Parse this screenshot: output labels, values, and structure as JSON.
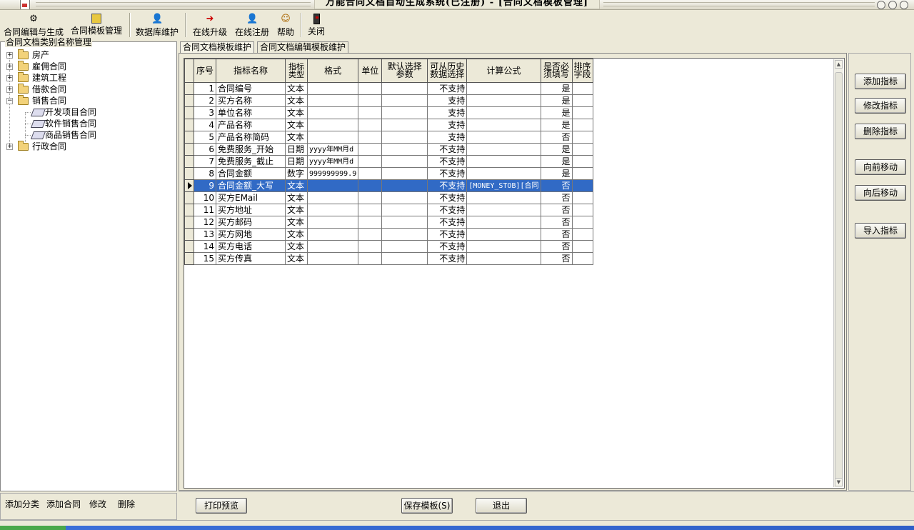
{
  "window": {
    "title": "万能合同文档自动生成系统(已注册) - [合同文档模板管理]"
  },
  "toolbar": [
    {
      "label": "合同编辑与生成",
      "icon": "gear-icon"
    },
    {
      "label": "合同模板管理",
      "icon": "template-icon"
    },
    {
      "label": "数据库维护",
      "icon": "database-person-icon"
    },
    {
      "label": "在线升级",
      "icon": "upgrade-arrow-icon"
    },
    {
      "label": "在线注册",
      "icon": "register-person-icon"
    },
    {
      "label": "帮助",
      "icon": "help-icon"
    },
    {
      "label": "关闭",
      "icon": "close-door-icon"
    }
  ],
  "left_panel": {
    "title": "合同文档类别名称管理",
    "tree": [
      {
        "label": "房产",
        "expander": "+"
      },
      {
        "label": "雇佣合同",
        "expander": "+"
      },
      {
        "label": "建筑工程",
        "expander": "+"
      },
      {
        "label": "借款合同",
        "expander": "+"
      },
      {
        "label": "销售合同",
        "expander": "−"
      },
      {
        "label": "开发项目合同",
        "expander": ""
      },
      {
        "label": "软件销售合同",
        "expander": ""
      },
      {
        "label": "商品销售合同",
        "expander": ""
      },
      {
        "label": "行政合同",
        "expander": "+"
      }
    ],
    "actions": [
      "添加分类",
      "添加合同",
      "修改",
      "删除"
    ]
  },
  "tabs": [
    "合同文档模板维护",
    "合同文档编辑模板维护"
  ],
  "grid": {
    "columns": [
      "序号",
      "指标名称",
      "指标类型",
      "格式",
      "单位",
      "默认选择参数",
      "可从历史数据选择",
      "计算公式",
      "是否必须填写",
      "排序字段"
    ],
    "rows": [
      [
        "1",
        "合同编号",
        "文本",
        "",
        "",
        "",
        "不支持",
        "",
        "是",
        ""
      ],
      [
        "2",
        "买方名称",
        "文本",
        "",
        "",
        "",
        "支持",
        "",
        "是",
        ""
      ],
      [
        "3",
        "单位名称",
        "文本",
        "",
        "",
        "",
        "支持",
        "",
        "是",
        ""
      ],
      [
        "4",
        "产品名称",
        "文本",
        "",
        "",
        "",
        "支持",
        "",
        "是",
        ""
      ],
      [
        "5",
        "产品名称简码",
        "文本",
        "",
        "",
        "",
        "支持",
        "",
        "否",
        ""
      ],
      [
        "6",
        "免费服务_开始",
        "日期",
        "yyyy年MM月d",
        "",
        "",
        "不支持",
        "",
        "是",
        ""
      ],
      [
        "7",
        "免费服务_截止",
        "日期",
        "yyyy年MM月d",
        "",
        "",
        "不支持",
        "",
        "是",
        ""
      ],
      [
        "8",
        "合同金额",
        "数字",
        "999999999.9",
        "",
        "",
        "不支持",
        "",
        "是",
        ""
      ],
      [
        "9",
        "合同金额_大写",
        "文本",
        "",
        "",
        "",
        "不支持",
        "[MONEY_STOB][合同",
        "否",
        ""
      ],
      [
        "10",
        "买方EMail",
        "文本",
        "",
        "",
        "",
        "不支持",
        "",
        "否",
        ""
      ],
      [
        "11",
        "买方地址",
        "文本",
        "",
        "",
        "",
        "不支持",
        "",
        "否",
        ""
      ],
      [
        "12",
        "买方邮码",
        "文本",
        "",
        "",
        "",
        "不支持",
        "",
        "否",
        ""
      ],
      [
        "13",
        "买方网地",
        "文本",
        "",
        "",
        "",
        "不支持",
        "",
        "否",
        ""
      ],
      [
        "14",
        "买方电话",
        "文本",
        "",
        "",
        "",
        "不支持",
        "",
        "否",
        ""
      ],
      [
        "15",
        "买方传真",
        "文本",
        "",
        "",
        "",
        "不支持",
        "",
        "否",
        ""
      ]
    ],
    "selected_row": 9
  },
  "right_buttons": [
    "添加指标",
    "修改指标",
    "删除指标",
    "向前移动",
    "向后移动",
    "导入指标"
  ],
  "bottom_buttons": {
    "print": "打印预览",
    "save": "保存模板(S)",
    "exit": "退出"
  },
  "colors": {
    "selection": "#316ac5",
    "window_bg": "#ece9d8"
  }
}
